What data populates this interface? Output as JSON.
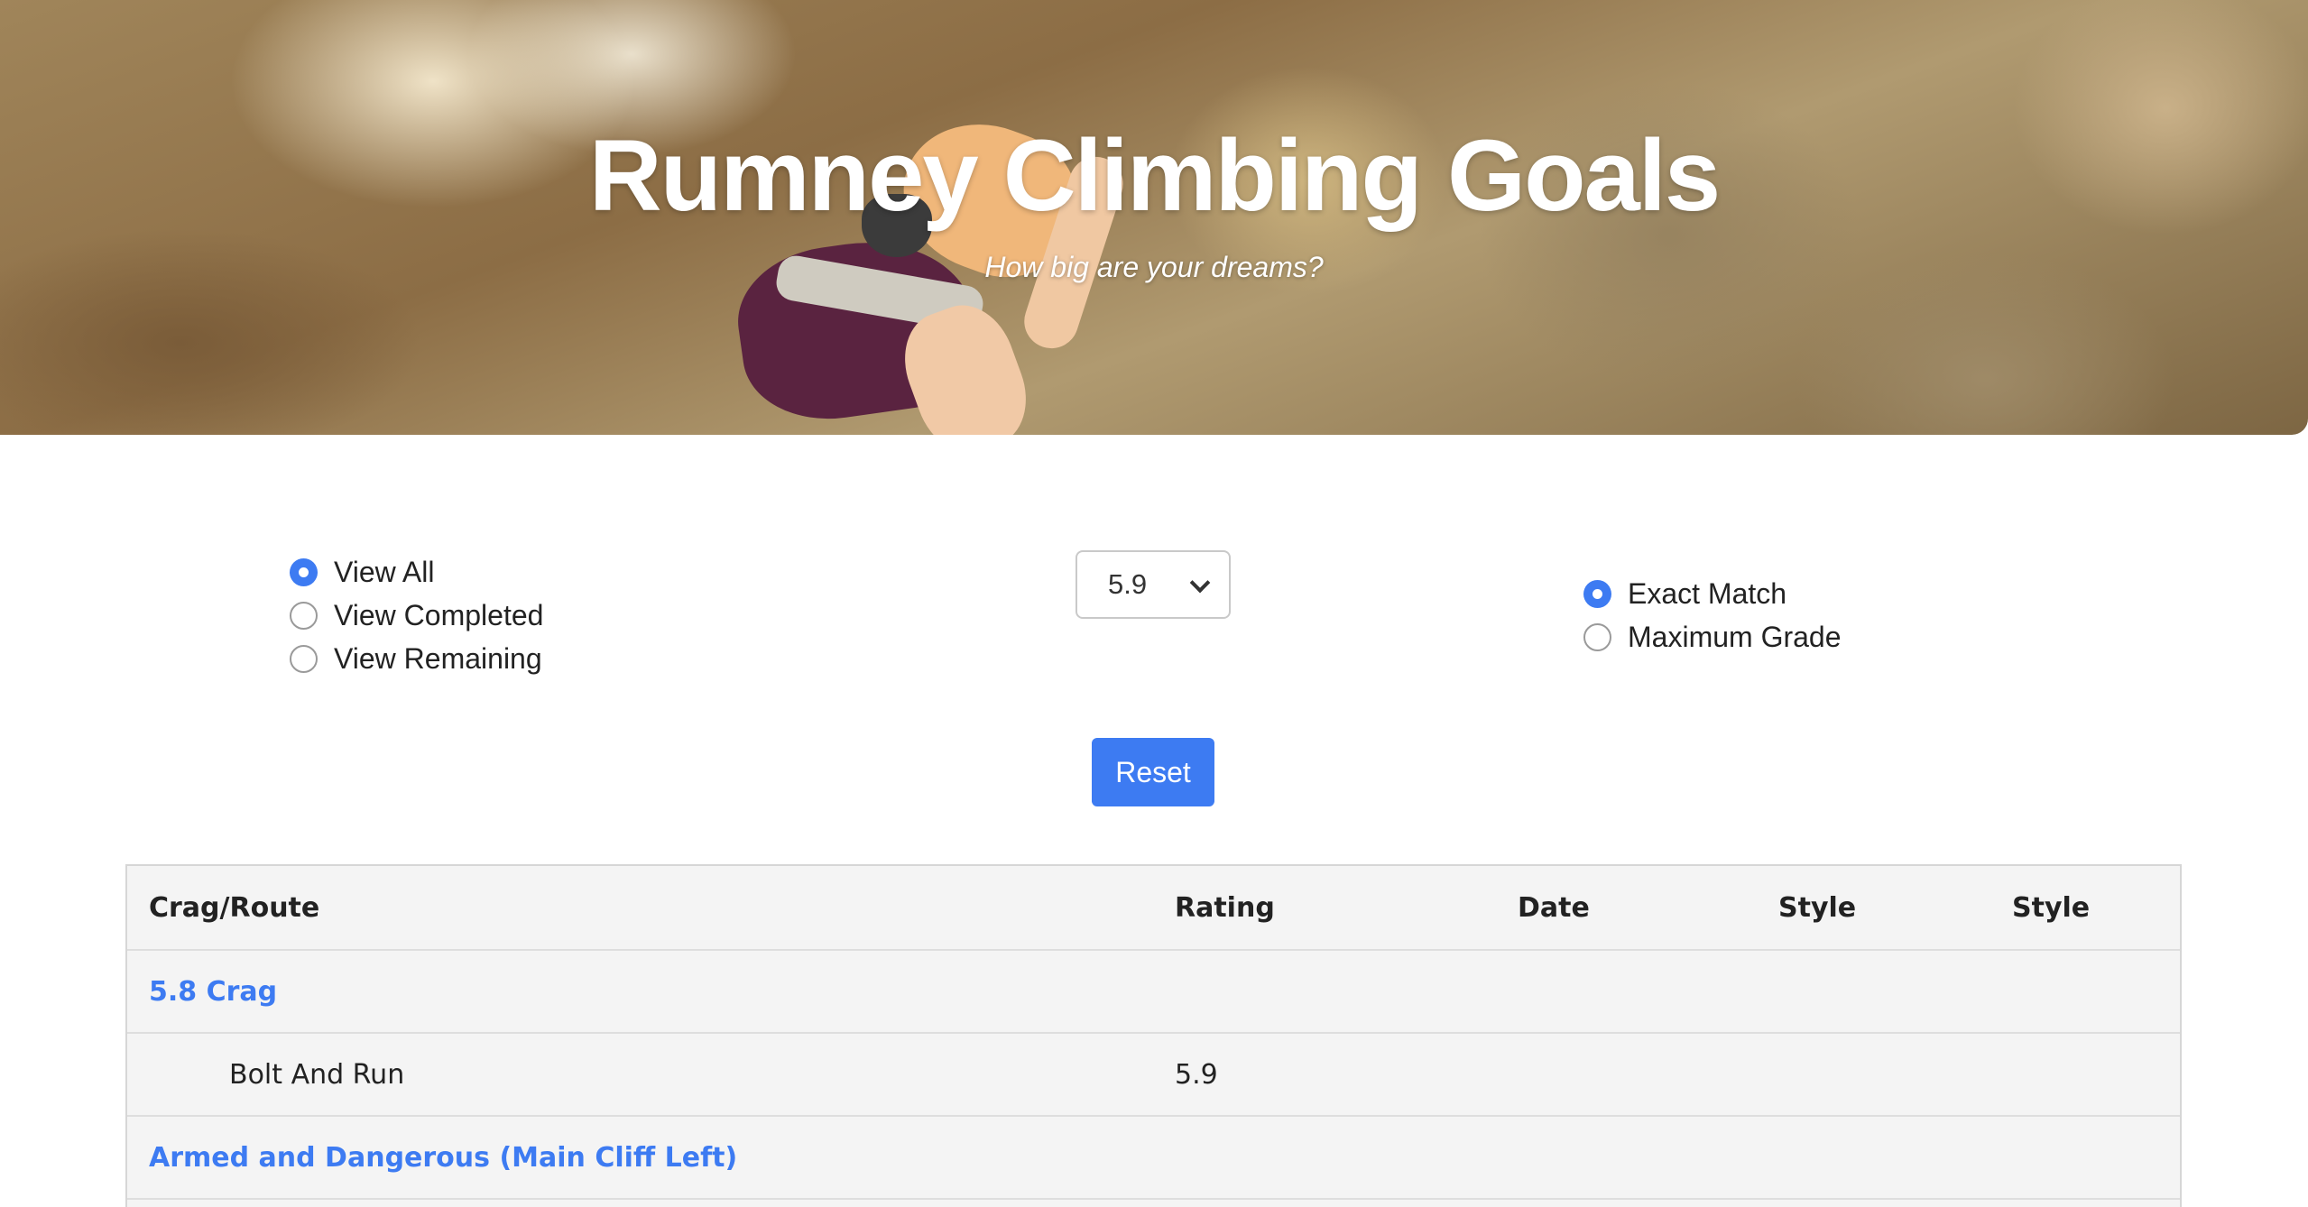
{
  "hero": {
    "title": "Rumney Climbing Goals",
    "subtitle": "How big are your dreams?"
  },
  "view_filter": {
    "options": [
      {
        "label": "View All",
        "checked": true
      },
      {
        "label": "View Completed",
        "checked": false
      },
      {
        "label": "View Remaining",
        "checked": false
      }
    ]
  },
  "grade_select": {
    "value": "5.9"
  },
  "match_filter": {
    "options": [
      {
        "label": "Exact Match",
        "checked": true
      },
      {
        "label": "Maximum Grade",
        "checked": false
      }
    ]
  },
  "reset_button": {
    "label": "Reset"
  },
  "table": {
    "headers": [
      "Crag/Route",
      "Rating",
      "Date",
      "Style",
      "Style"
    ],
    "rows": [
      {
        "type": "crag",
        "name": "5.8 Crag"
      },
      {
        "type": "route",
        "name": "Bolt And Run",
        "rating": "5.9"
      },
      {
        "type": "crag",
        "name": "Armed and Dangerous (Main Cliff Left)"
      }
    ]
  },
  "colors": {
    "accent": "#3d7bf2",
    "table_bg": "#f4f4f4"
  }
}
